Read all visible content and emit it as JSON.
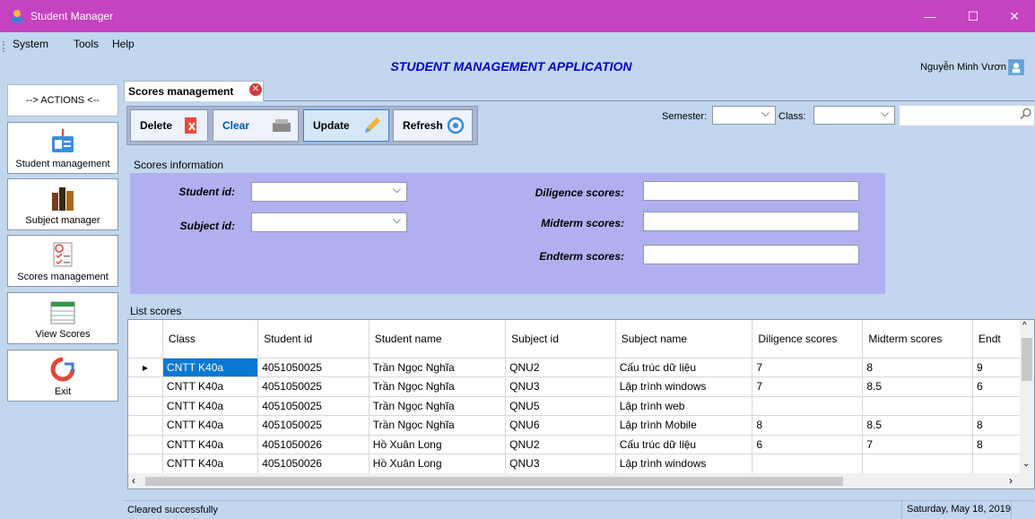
{
  "window": {
    "title": "Student Manager",
    "minimize": "—",
    "maximize": "☐",
    "close": "✕"
  },
  "menu": {
    "system": "System",
    "tools": "Tools",
    "help": "Help"
  },
  "app_heading": "STUDENT MANAGEMENT APPLICATION",
  "user": {
    "name": "Nguyễn Minh Vươn"
  },
  "sidebar": {
    "header": "--> ACTIONS <--",
    "items": [
      {
        "label": "Student management",
        "icon": "student-card-icon"
      },
      {
        "label": "Subject manager",
        "icon": "books-icon"
      },
      {
        "label": "Scores management",
        "icon": "checklist-icon"
      },
      {
        "label": "View Scores",
        "icon": "spreadsheet-icon"
      },
      {
        "label": "Exit",
        "icon": "exit-icon"
      }
    ]
  },
  "tab": {
    "label": "Scores management"
  },
  "toolbar": {
    "delete": "Delete",
    "clear": "Clear",
    "update": "Update",
    "refresh": "Refresh"
  },
  "filters": {
    "semester_label": "Semester:",
    "semester_value": "",
    "class_label": "Class:",
    "class_value": "",
    "search_value": ""
  },
  "info": {
    "title": "Scores information",
    "student_id_label": "Student id:",
    "subject_id_label": "Subject id:",
    "diligence_label": "Diligence scores:",
    "midterm_label": "Midterm scores:",
    "endterm_label": "Endterm scores:"
  },
  "list": {
    "title": "List scores",
    "columns": [
      "Class",
      "Student id",
      "Student name",
      "Subject id",
      "Subject name",
      "Diligence scores",
      "Midterm scores",
      "Endt"
    ],
    "rows": [
      [
        "CNTT K40a",
        "4051050025",
        "Trần Ngọc Nghĩa",
        "QNU2",
        "Cấu trúc dữ liệu",
        "7",
        "8",
        "9"
      ],
      [
        "CNTT K40a",
        "4051050025",
        "Trần Ngọc Nghĩa",
        "QNU3",
        "Lập trình windows",
        "7",
        "8.5",
        "6"
      ],
      [
        "CNTT K40a",
        "4051050025",
        "Trần Ngọc Nghĩa",
        "QNU5",
        "Lập trình web",
        "",
        "",
        ""
      ],
      [
        "CNTT K40a",
        "4051050025",
        "Trần Ngọc Nghĩa",
        "QNU6",
        "Lập trình Mobile",
        "8",
        "8.5",
        "8"
      ],
      [
        "CNTT K40a",
        "4051050026",
        "Hồ Xuân Long",
        "QNU2",
        "Cấu trúc dữ liệu",
        "6",
        "7",
        "8"
      ],
      [
        "CNTT K40a",
        "4051050026",
        "Hồ Xuân Long",
        "QNU3",
        "Lập trình windows",
        "",
        "",
        ""
      ]
    ],
    "current_row_marker": "▸"
  },
  "status": {
    "message": "Cleared successfully",
    "date": "Saturday, May 18, 2019"
  }
}
